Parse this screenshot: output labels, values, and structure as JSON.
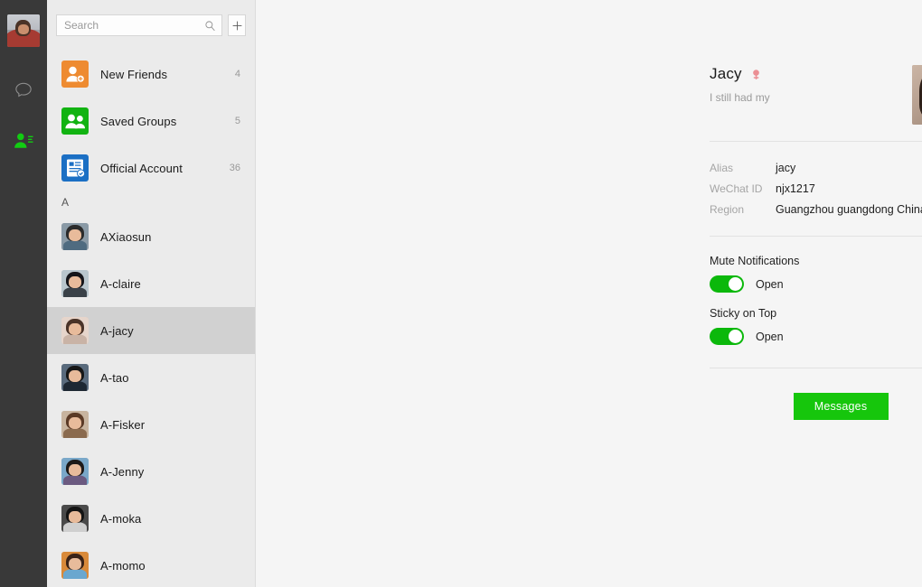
{
  "nav": {
    "avatar_name": "my-profile-avatar",
    "items": [
      {
        "name": "chats",
        "icon": "chat-bubble-icon",
        "active": false
      },
      {
        "name": "contacts",
        "icon": "contacts-person-icon",
        "active": true
      }
    ]
  },
  "search": {
    "placeholder": "Search",
    "value": "",
    "icon": "search-icon",
    "add_icon": "plus-icon"
  },
  "list": {
    "special": [
      {
        "label": "New Friends",
        "count": "4",
        "icon": "new-friends-icon",
        "color": "#ee8b31"
      },
      {
        "label": "Saved Groups",
        "count": "5",
        "icon": "saved-groups-icon",
        "color": "#12b312"
      },
      {
        "label": "Official Account",
        "count": "36",
        "icon": "official-account-icon",
        "color": "#1b6fc4"
      }
    ],
    "group_letter": "A",
    "contacts": [
      {
        "label": "AXiaosun",
        "selected": false,
        "bg": "#8a9aa6",
        "hair": "#2b2b2b",
        "torso": "#4f6b80"
      },
      {
        "label": "A-claire",
        "selected": false,
        "bg": "#b9c6cd",
        "hair": "#15151a",
        "torso": "#3a4148"
      },
      {
        "label": "A-jacy",
        "selected": true,
        "bg": "#e6d5cb",
        "hair": "#4a3328",
        "torso": "#c9b3a6"
      },
      {
        "label": "A-tao",
        "selected": false,
        "bg": "#5a6b7d",
        "hair": "#171717",
        "torso": "#1e2833"
      },
      {
        "label": "A-Fisker",
        "selected": false,
        "bg": "#c8b49f",
        "hair": "#5b3a26",
        "torso": "#8a6a4e"
      },
      {
        "label": "A-Jenny",
        "selected": false,
        "bg": "#7aa8c9",
        "hair": "#1d1a19",
        "torso": "#6b5a80"
      },
      {
        "label": "A-moka",
        "selected": false,
        "bg": "#4a4a4a",
        "hair": "#141414",
        "torso": "#cfcfcf"
      },
      {
        "label": "A-momo",
        "selected": false,
        "bg": "#d98a3a",
        "hair": "#3a2318",
        "torso": "#6aa7cf"
      }
    ]
  },
  "detail": {
    "name": "Jacy",
    "gender_icon": "female-gender-icon",
    "gender_color": "#eb8f94",
    "signature": "I still had my",
    "avatar_name": "contact-avatar",
    "info": [
      {
        "key": "Alias",
        "value": "jacy"
      },
      {
        "key": "WeChat ID",
        "value": "njx1217"
      },
      {
        "key": "Region",
        "value": "Guangzhou guangdong China"
      }
    ],
    "settings": [
      {
        "label": "Mute Notifications",
        "state": "Open",
        "on": true
      },
      {
        "label": "Sticky on Top",
        "state": "Open",
        "on": true
      }
    ],
    "primary_action": "Messages",
    "accent_color": "#16c60c"
  }
}
